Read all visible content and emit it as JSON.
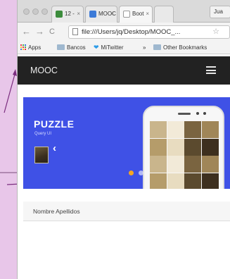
{
  "browser": {
    "tabs": [
      {
        "label": "12 - ",
        "favicon_color": "#3c8c3c",
        "active": false
      },
      {
        "label": "MOOC",
        "favicon_color": "#3d7bd8",
        "active": false
      },
      {
        "label": "Boot",
        "favicon_color": "#ffffff",
        "active": false
      }
    ],
    "user_tab_label": "Jua",
    "close_glyph": "×",
    "address": "file:///Users/jq/Desktop/MOOC_...",
    "nav": {
      "back": "←",
      "forward": "→",
      "reload": "C"
    },
    "bookmarks": {
      "apps": "Apps",
      "bancos": "Bancos",
      "mitwitter": "MiTwitter",
      "overflow": "»",
      "other": "Other Bookmarks"
    }
  },
  "app": {
    "title": "MOOC"
  },
  "slider": {
    "title": "PUZZLE",
    "subtitle": "Query UI",
    "prev_arrow": "‹",
    "next_arrow": "›",
    "accent_color": "#3f51e6",
    "active_dot_color": "#f5a623"
  },
  "profile": {
    "name": "Nombre Apellidos"
  },
  "icons": [
    "puzzle-tile",
    "hamburger-menu-icon",
    "star-icon",
    "page-icon",
    "folder-icon"
  ]
}
